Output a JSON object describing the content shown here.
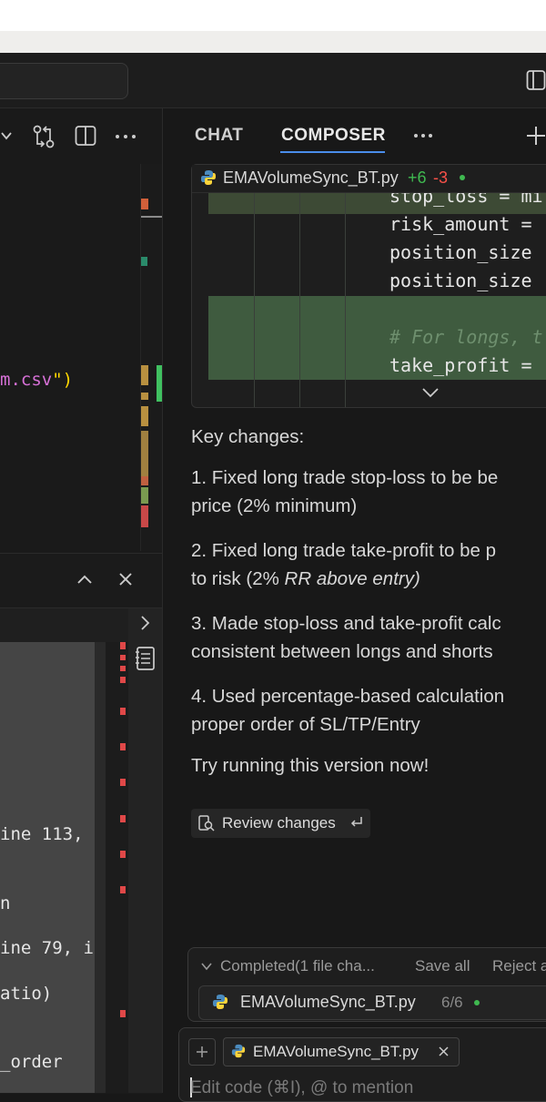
{
  "editor": {
    "code_fragment": "m.csv\")",
    "code_fragment_main": "m.csv",
    "code_fragment_tail": "\")"
  },
  "terminal": {
    "lines": [
      "ine 113,",
      "n",
      "ine 79, i",
      "atio)",
      "_order"
    ]
  },
  "chat": {
    "tabs": [
      "CHAT",
      "COMPOSER"
    ],
    "active_tab": "COMPOSER",
    "diff": {
      "filename": "EMAVolumeSync_BT.py",
      "added": "+6",
      "removed": "-3",
      "lines": [
        "stop_loss = mi",
        "risk_amount =",
        "position_size",
        "position_size",
        "",
        "# For longs, t",
        "take_profit ="
      ]
    },
    "message": {
      "heading": "Key changes:",
      "items": [
        {
          "line1": "1. Fixed long trade stop-loss to be be",
          "line2": "price (2% minimum)"
        },
        {
          "line1": "2. Fixed long trade take-profit to be p",
          "line2_a": "to risk (2% ",
          "line2_b": "RR above entry)"
        },
        {
          "line1": "3. Made stop-loss and take-profit calc",
          "line2": "consistent between longs and shorts"
        },
        {
          "line1": "4. Used percentage-based calculation",
          "line2": "proper order of SL/TP/Entry"
        }
      ],
      "closing": "Try running this version now!"
    },
    "review_button": "Review changes",
    "completed": {
      "label": "Completed",
      "detail": "(1 file cha...",
      "save_all": "Save all",
      "reject_all": "Reject a",
      "file": "EMAVolumeSync_BT.py",
      "progress": "6/6"
    },
    "input": {
      "context_file": "EMAVolumeSync_BT.py",
      "placeholder": "Edit code (⌘I), @ to mention"
    }
  },
  "colors": {
    "accent_blue": "#4a8dea",
    "added_green": "#3fb950",
    "removed_red": "#f85149",
    "diff_add_bg": "#3f5b3f",
    "python_blue": "#4b8bbe",
    "python_yellow": "#ffd43b",
    "string_pink": "#d670d6",
    "error_red": "#e04848"
  },
  "icons": [
    "chevron-down-icon",
    "compare-changes-icon",
    "split-editor-icon",
    "more-icon",
    "chevron-up-icon",
    "close-icon",
    "chevron-right-icon",
    "notebook-icon",
    "plus-icon",
    "python-icon",
    "review-icon",
    "enter-icon",
    "layout-icon"
  ]
}
